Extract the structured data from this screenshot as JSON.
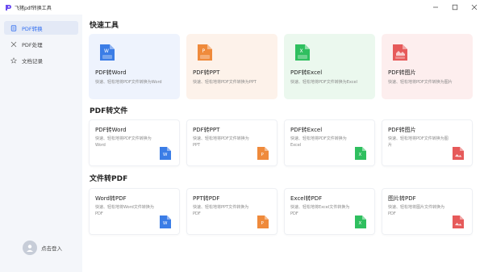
{
  "app": {
    "title": "飞猪pdf转换工具"
  },
  "sidebar": {
    "items": [
      {
        "label": "PDF转换",
        "icon": "document-icon",
        "active": true
      },
      {
        "label": "PDF处理",
        "icon": "tools-icon",
        "active": false
      },
      {
        "label": "文档记录",
        "icon": "star-icon",
        "active": false
      }
    ],
    "login_label": "点击登入"
  },
  "quick": {
    "heading": "快速工具",
    "cards": [
      {
        "title": "PDF转Word",
        "desc": "快速、轻松地将PDF文件转换为Word",
        "icon": "word-file-icon",
        "color": "#3b7de6",
        "bg": "#eef3fd"
      },
      {
        "title": "PDF转PPT",
        "desc": "快速、轻松地将PDF文件转换为PPT",
        "icon": "ppt-file-icon",
        "color": "#ef8a3b",
        "bg": "#fdf2ea"
      },
      {
        "title": "PDF转Excel",
        "desc": "快速、轻松地将PDF文件转换为Excel",
        "icon": "excel-file-icon",
        "color": "#2fbf5f",
        "bg": "#ebf8ee"
      },
      {
        "title": "PDF转图片",
        "desc": "快速、轻松地将PDF文件转换为图片",
        "icon": "image-file-icon",
        "color": "#e65a5a",
        "bg": "#fdeeee"
      }
    ]
  },
  "pdf_to": {
    "heading": "PDF转文件",
    "cards": [
      {
        "title": "PDF转Word",
        "desc": "快速、轻松地将PDF文件转换为Word",
        "icon": "word-file-icon",
        "color": "#3b7de6"
      },
      {
        "title": "PDF转PPT",
        "desc": "快速、轻松地将PDF文件转换为PPT",
        "icon": "ppt-file-icon",
        "color": "#ef8a3b"
      },
      {
        "title": "PDF转Excel",
        "desc": "快速、轻松地将PDF文件转换为Excel",
        "icon": "excel-file-icon",
        "color": "#2fbf5f"
      },
      {
        "title": "PDF转图片",
        "desc": "快速、轻松地将PDF文件转换为图片",
        "icon": "image-file-icon",
        "color": "#e65a5a"
      }
    ]
  },
  "to_pdf": {
    "heading": "文件转PDF",
    "cards": [
      {
        "title": "Word转PDF",
        "desc": "快速、轻松地将Word文件转换为PDF",
        "icon": "word-file-icon",
        "color": "#3b7de6"
      },
      {
        "title": "PPT转PDF",
        "desc": "快速、轻松地将PPT文件转换为PDF",
        "icon": "ppt-file-icon",
        "color": "#ef8a3b"
      },
      {
        "title": "Excel转PDF",
        "desc": "快速、轻松地将Excel文件转换为PDF",
        "icon": "excel-file-icon",
        "color": "#2fbf5f"
      },
      {
        "title": "图片转PDF",
        "desc": "快速、轻松地将图片文件转换为PDF",
        "icon": "image-file-icon",
        "color": "#e65a5a"
      }
    ]
  }
}
